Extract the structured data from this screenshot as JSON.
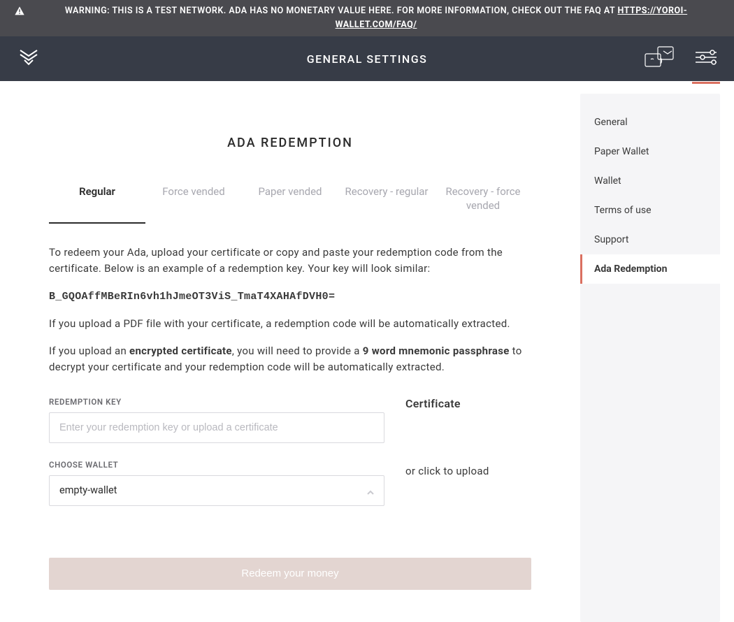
{
  "banner": {
    "text": "WARNING: THIS IS A TEST NETWORK. ADA HAS NO MONETARY VALUE HERE. FOR MORE INFORMATION, CHECK OUT THE FAQ AT ",
    "link_text": "HTTPS://YOROI-WALLET.COM/FAQ/"
  },
  "header": {
    "title": "GENERAL SETTINGS"
  },
  "sidebar": {
    "items": [
      {
        "label": "General"
      },
      {
        "label": "Paper Wallet"
      },
      {
        "label": "Wallet"
      },
      {
        "label": "Terms of use"
      },
      {
        "label": "Support"
      },
      {
        "label": "Ada Redemption"
      }
    ]
  },
  "main": {
    "title": "ADA REDEMPTION",
    "tabs": [
      {
        "label": "Regular"
      },
      {
        "label": "Force vended"
      },
      {
        "label": "Paper vended"
      },
      {
        "label": "Recovery - regular"
      },
      {
        "label": "Recovery - force vended"
      }
    ],
    "instructions": {
      "p1": "To redeem your Ada, upload your certificate or copy and paste your redemption code from the certificate. Below is an example of a redemption key. Your key will look similar:",
      "sample_key": "B_GQOAffMBeRIn6vh1hJmeOT3ViS_TmaT4XAHAfDVH0=",
      "p2": "If you upload a PDF file with your certificate, a redemption code will be automatically extracted.",
      "p3_a": "If you upload an ",
      "p3_b": "encrypted certificate",
      "p3_c": ", you will need to provide a ",
      "p3_d": "9 word mnemonic passphrase",
      "p3_e": " to decrypt your certificate and your redemption code will be automatically extracted."
    },
    "form": {
      "redemption_label": "REDEMPTION KEY",
      "redemption_placeholder": "Enter your redemption key or upload a certificate",
      "redemption_value": "",
      "wallet_label": "CHOOSE WALLET",
      "wallet_value": "empty-wallet",
      "certificate_title": "Certificate",
      "certificate_hint": "or click to upload",
      "submit_label": "Redeem your money"
    }
  }
}
